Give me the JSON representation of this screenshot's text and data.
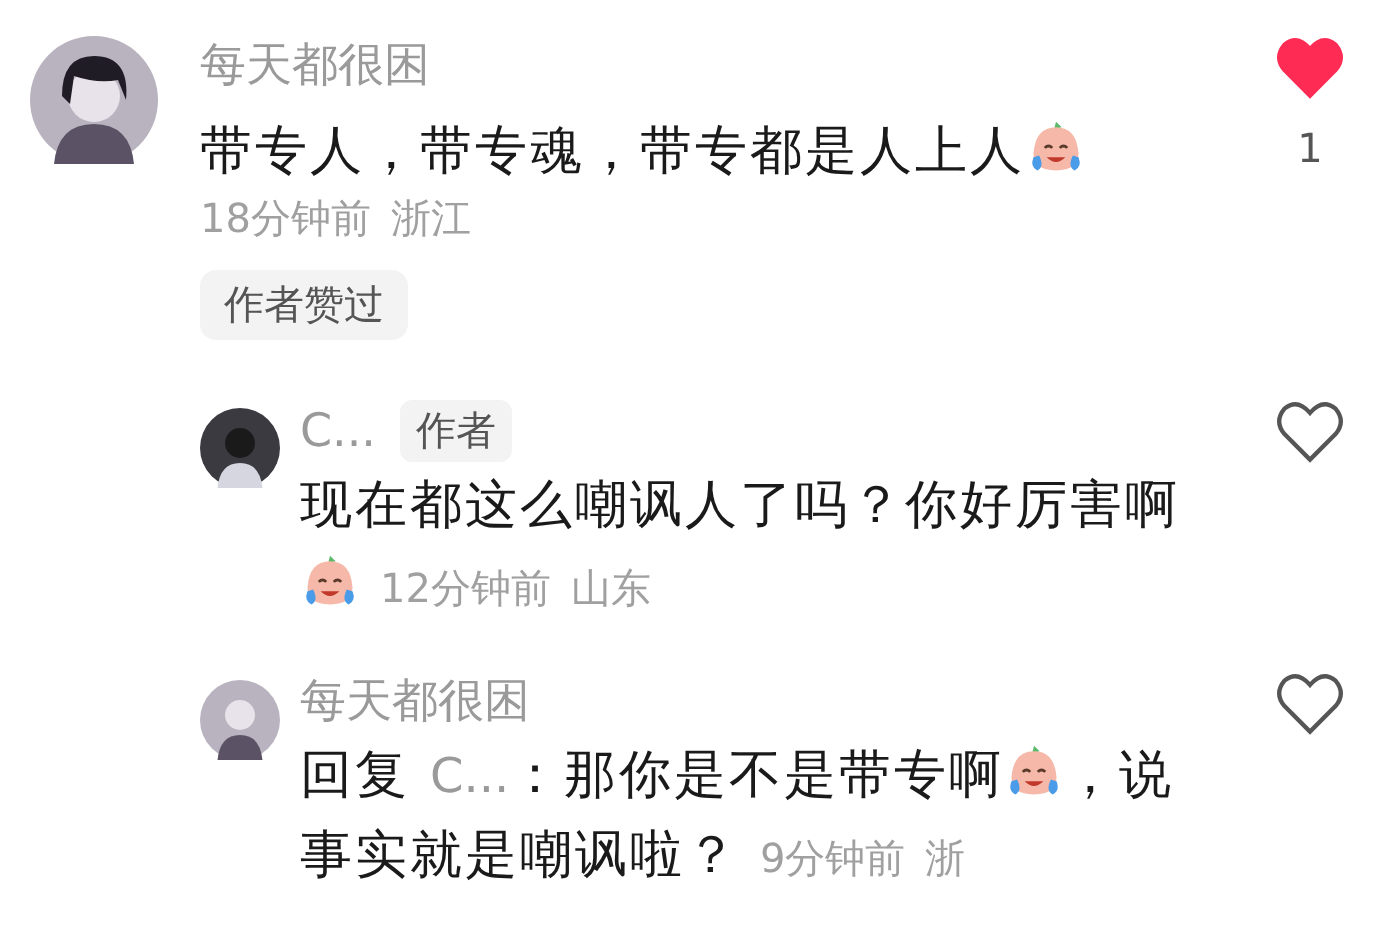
{
  "comment": {
    "user": {
      "name": "每天都很困"
    },
    "content": [
      {
        "kind": "text",
        "text": "带专人，带专魂，带专都是人上人"
      },
      {
        "kind": "emoji"
      }
    ],
    "time": "18分钟前",
    "location": "浙江",
    "badge": "作者赞过",
    "liked": true,
    "like_count": "1",
    "replies": [
      {
        "user": {
          "name": "C...",
          "badge": "作者"
        },
        "content": [
          {
            "kind": "text",
            "text": "现在都这么嘲讽人了吗？你好厉害啊"
          },
          {
            "kind": "emoji"
          }
        ],
        "time": "12分钟前",
        "location": "山东",
        "liked": false
      },
      {
        "user": {
          "name": "每天都很困"
        },
        "content": [
          {
            "kind": "text",
            "text": "回复"
          },
          {
            "kind": "mention",
            "text": "C..."
          },
          {
            "kind": "text",
            "text": "：那你是不是带专啊"
          },
          {
            "kind": "emoji"
          },
          {
            "kind": "text",
            "text": "，说"
          },
          {
            "kind": "text",
            "text": "事实就是嘲讽啦？"
          }
        ],
        "time": "9分钟前",
        "location": "浙",
        "liked": false
      }
    ]
  }
}
